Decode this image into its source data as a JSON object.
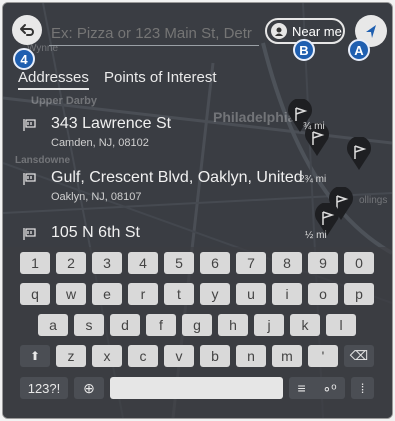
{
  "map": {
    "labels": [
      "Philadelphia",
      "Wynne",
      "Upper Darby",
      "Lansdowne",
      "ollings"
    ]
  },
  "search": {
    "placeholder": "Ex: Pizza or 123 Main St, Detr",
    "near_me_label": "Near me"
  },
  "callouts": {
    "back": "4",
    "near_me": "B",
    "navigate": "A"
  },
  "tabs": [
    {
      "label": "Addresses",
      "active": true
    },
    {
      "label": "Points of Interest",
      "active": false
    }
  ],
  "results": [
    {
      "title": "343 Lawrence St",
      "subtitle": "Camden, NJ, 08102",
      "distance": "¾ mi"
    },
    {
      "title": "Gulf, Crescent Blvd, Oaklyn, United",
      "subtitle": "Oaklyn, NJ, 08107",
      "distance": "2¾ mi"
    },
    {
      "title": "105 N 6th St",
      "subtitle": "",
      "distance": "½ mi"
    }
  ],
  "keyboard": {
    "row1": [
      "1",
      "2",
      "3",
      "4",
      "5",
      "6",
      "7",
      "8",
      "9",
      "0"
    ],
    "row2": [
      "q",
      "w",
      "e",
      "r",
      "t",
      "y",
      "u",
      "i",
      "o",
      "p"
    ],
    "row3": [
      "a",
      "s",
      "d",
      "f",
      "g",
      "h",
      "j",
      "k",
      "l"
    ],
    "row4": [
      "z",
      "x",
      "c",
      "v",
      "b",
      "n",
      "m",
      "'"
    ],
    "shift": "⬆",
    "backspace": "⌫",
    "symbols": "123?!",
    "globe": "⊕",
    "list": "≡",
    "route": "∘ᵒ",
    "keypad": "⁞"
  },
  "colors": {
    "accent": "#1f5fb0",
    "background": "#3b3e44"
  }
}
